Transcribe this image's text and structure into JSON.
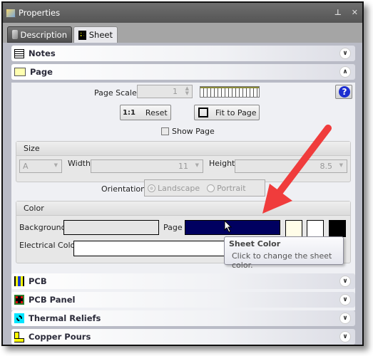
{
  "window": {
    "title": "Properties",
    "pin_icon": "pin-icon",
    "close_icon": "close-icon"
  },
  "tabs": [
    {
      "label": "Description",
      "icon": "description-icon",
      "active": false
    },
    {
      "label": "Sheet",
      "icon": "sheet-icon",
      "active": true
    }
  ],
  "sections": {
    "notes": {
      "label": "Notes",
      "icon": "notes-icon",
      "expanded": false
    },
    "page": {
      "label": "Page",
      "icon": "page-icon",
      "expanded": true
    },
    "pcb": {
      "label": "PCB",
      "icon": "pcb-icon",
      "expanded": false
    },
    "pcb_panel": {
      "label": "PCB Panel",
      "icon": "pcb-panel-icon",
      "expanded": false
    },
    "thermal_reliefs": {
      "label": "Thermal Reliefs",
      "icon": "thermal-reliefs-icon",
      "expanded": false
    },
    "copper_pours": {
      "label": "Copper Pours",
      "icon": "copper-pours-icon",
      "expanded": false
    }
  },
  "page": {
    "page_scale_label": "Page Scale",
    "page_scale_value": "1",
    "reset_icon_text": "1:1",
    "reset_label": "Reset",
    "fit_label": "Fit to Page",
    "show_page_label": "Show Page",
    "show_page_checked": false,
    "size": {
      "header": "Size",
      "size_value": "A",
      "width_label": "Width",
      "width_value": "11",
      "height_label": "Height",
      "height_value": "8.5"
    },
    "orientation_label": "Orientation",
    "orientation_options": [
      "Landscape",
      "Portrait"
    ],
    "color": {
      "header": "Color",
      "background_label": "Background",
      "page_label": "Page",
      "electrical_label": "Electrical Color",
      "page_color": "#000060",
      "preset_colors": [
        "#fffde8",
        "#ffffff",
        "#000000"
      ]
    }
  },
  "tooltip": {
    "title": "Sheet Color",
    "body": "Click to change the sheet color."
  },
  "annotation": {
    "arrow_color": "#f03c3c"
  }
}
